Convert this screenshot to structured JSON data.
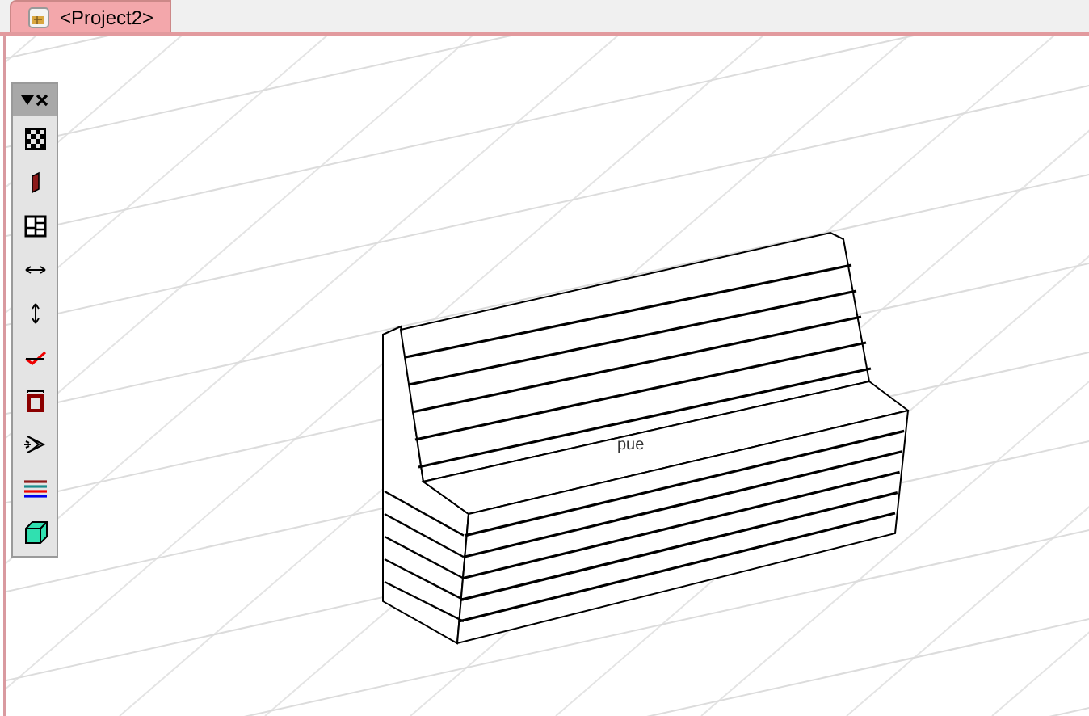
{
  "tabs": [
    {
      "label": "<Project2>",
      "selected": true
    }
  ],
  "model": {
    "label": "pue"
  }
}
